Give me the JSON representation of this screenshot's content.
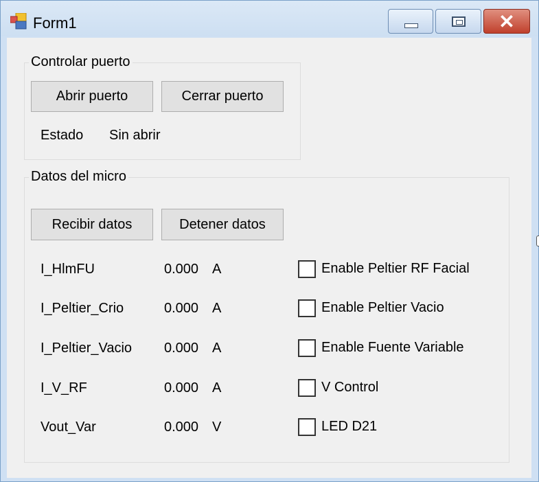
{
  "window": {
    "title": "Form1",
    "close_glyph": "✕"
  },
  "controlar_puerto": {
    "title": "Controlar puerto",
    "open_button": "Abrir puerto",
    "close_button": "Cerrar puerto",
    "status_label": "Estado",
    "status_value": "Sin abrir"
  },
  "datos_micro": {
    "title": "Datos del micro",
    "receive_button": "Recibir datos",
    "stop_button": "Detener datos",
    "readings": [
      {
        "name": "I_HlmFU",
        "value": "0.000",
        "unit": "A"
      },
      {
        "name": "I_Peltier_Crio",
        "value": "0.000",
        "unit": "A"
      },
      {
        "name": "I_Peltier_Vacio",
        "value": "0.000",
        "unit": "A"
      },
      {
        "name": "I_V_RF",
        "value": "0.000",
        "unit": "A"
      },
      {
        "name": "Vout_Var",
        "value": "0.000",
        "unit": "V"
      }
    ],
    "checkboxes": [
      {
        "label": "Enable Peltier RF Facial",
        "checked": false
      },
      {
        "label": "Enable Peltier Vacio",
        "checked": false
      },
      {
        "label": "Enable Fuente Variable",
        "checked": false
      },
      {
        "label": "V Control",
        "checked": false
      },
      {
        "label": "LED D21",
        "checked": false
      }
    ]
  },
  "icons": {
    "app": "app-icon",
    "minimize": "minimize-icon",
    "maximize": "maximize-icon",
    "close": "close-icon"
  },
  "colors": {
    "titlebar": "#cddff2",
    "client": "#f0f0f0",
    "button_face": "#e1e1e1",
    "close_button": "#c0402c"
  }
}
